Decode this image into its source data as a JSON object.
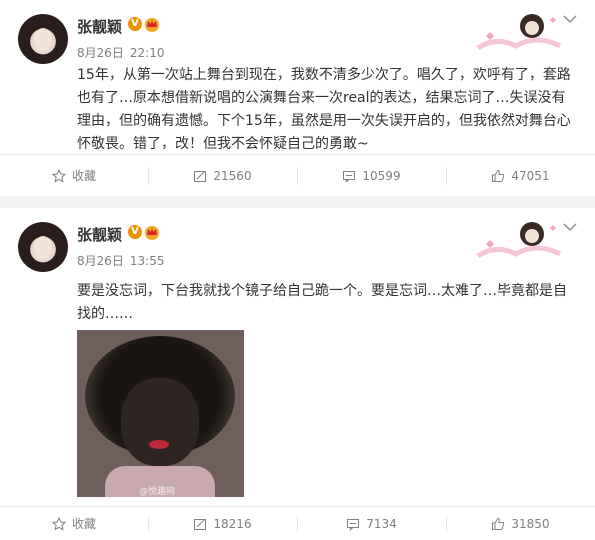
{
  "colors": {
    "verified_badge": "#f09200",
    "text_primary": "#333333",
    "text_secondary": "#808080",
    "separator": "#f2f2f5"
  },
  "posts": [
    {
      "username": "张靓颖",
      "date": "8月26日",
      "time": "22:10",
      "content": "15年，从第一次站上舞台到现在，我数不清多少次了。唱久了，欢呼有了，套路也有了…原本想借新说唱的公演舞台来一次real的表达，结果忘词了…失误没有理由，但的确有遗憾。下个15年，虽然是用一次失误开启的，但我依然对舞台心怀敬畏。错了，改！但我不会怀疑自己的勇敢~",
      "actions": {
        "favorite": "收藏",
        "repost": "21560",
        "comment": "10599",
        "like": "47051"
      }
    },
    {
      "username": "张靓颖",
      "date": "8月26日",
      "time": "13:55",
      "content": "要是没忘词，下台我就找个镜子给自己跪一个。要是忘词…太难了…毕竟都是自找的……",
      "image_watermark": "@悦趣网",
      "actions": {
        "favorite": "收藏",
        "repost": "18216",
        "comment": "7134",
        "like": "31850"
      }
    }
  ],
  "icons": [
    "avatar",
    "verified-icon",
    "crown-icon",
    "decoration-icon",
    "chevron-down-icon",
    "star-icon",
    "repost-icon",
    "comment-icon",
    "like-icon"
  ]
}
